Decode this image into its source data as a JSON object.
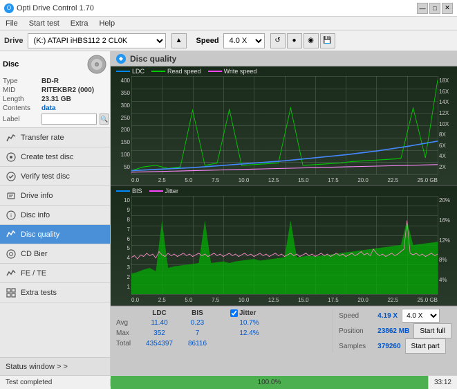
{
  "titlebar": {
    "title": "Opti Drive Control 1.70",
    "min_btn": "—",
    "max_btn": "□",
    "close_btn": "✕"
  },
  "menubar": {
    "items": [
      "File",
      "Start test",
      "Extra",
      "Help"
    ]
  },
  "drivebar": {
    "label": "Drive",
    "drive_value": "(K:) ATAPI iHBS112  2 CL0K",
    "speed_label": "Speed",
    "speed_value": "4.0 X"
  },
  "disc": {
    "header": "Disc",
    "type_label": "Type",
    "type_value": "BD-R",
    "mid_label": "MID",
    "mid_value": "RITEKBR2 (000)",
    "length_label": "Length",
    "length_value": "23.31 GB",
    "contents_label": "Contents",
    "contents_value": "data",
    "label_label": "Label",
    "label_value": ""
  },
  "sidebar": {
    "items": [
      {
        "id": "transfer-rate",
        "label": "Transfer rate",
        "icon": "chart-icon"
      },
      {
        "id": "create-test-disc",
        "label": "Create test disc",
        "icon": "disc-icon"
      },
      {
        "id": "verify-test-disc",
        "label": "Verify test disc",
        "icon": "check-icon"
      },
      {
        "id": "drive-info",
        "label": "Drive info",
        "icon": "info-icon"
      },
      {
        "id": "disc-info",
        "label": "Disc info",
        "icon": "disc-info-icon"
      },
      {
        "id": "disc-quality",
        "label": "Disc quality",
        "icon": "quality-icon",
        "active": true
      },
      {
        "id": "cd-bier",
        "label": "CD Bier",
        "icon": "cd-icon"
      },
      {
        "id": "fe-te",
        "label": "FE / TE",
        "icon": "fe-icon"
      },
      {
        "id": "extra-tests",
        "label": "Extra tests",
        "icon": "extra-icon"
      }
    ],
    "status_window": "Status window > >"
  },
  "quality": {
    "title": "Disc quality",
    "legend": {
      "ldc": "LDC",
      "read_speed": "Read speed",
      "write_speed": "Write speed",
      "bis": "BIS",
      "jitter": "Jitter"
    },
    "chart1": {
      "y_labels_left": [
        "400",
        "350",
        "300",
        "250",
        "200",
        "150",
        "100",
        "50"
      ],
      "y_labels_right": [
        "18X",
        "16X",
        "14X",
        "12X",
        "10X",
        "8X",
        "6X",
        "4X",
        "2X"
      ],
      "x_labels": [
        "0.0",
        "2.5",
        "5.0",
        "7.5",
        "10.0",
        "12.5",
        "15.0",
        "17.5",
        "20.0",
        "22.5",
        "25.0 GB"
      ]
    },
    "chart2": {
      "y_labels_left": [
        "10",
        "9",
        "8",
        "7",
        "6",
        "5",
        "4",
        "3",
        "2",
        "1"
      ],
      "y_labels_right": [
        "20%",
        "16%",
        "12%",
        "8%",
        "4%"
      ],
      "x_labels": [
        "0.0",
        "2.5",
        "5.0",
        "7.5",
        "10.0",
        "12.5",
        "15.0",
        "17.5",
        "20.0",
        "22.5",
        "25.0 GB"
      ]
    }
  },
  "stats": {
    "col_headers": [
      "LDC",
      "BIS",
      "Jitter",
      "Speed"
    ],
    "avg_label": "Avg",
    "max_label": "Max",
    "total_label": "Total",
    "avg_ldc": "11.40",
    "avg_bis": "0.23",
    "avg_jitter": "10.7%",
    "max_ldc": "352",
    "max_bis": "7",
    "max_jitter": "12.4%",
    "total_ldc": "4354397",
    "total_bis": "86116",
    "speed_label": "Speed",
    "speed_value": "4.19 X",
    "speed_select": "4.0 X",
    "position_label": "Position",
    "position_value": "23862 MB",
    "samples_label": "Samples",
    "samples_value": "379260",
    "start_full_label": "Start full",
    "start_part_label": "Start part",
    "jitter_checked": true
  },
  "statusbar": {
    "status_text": "Test completed",
    "progress_percent": 100,
    "progress_label": "100.0%",
    "time": "33:12"
  }
}
